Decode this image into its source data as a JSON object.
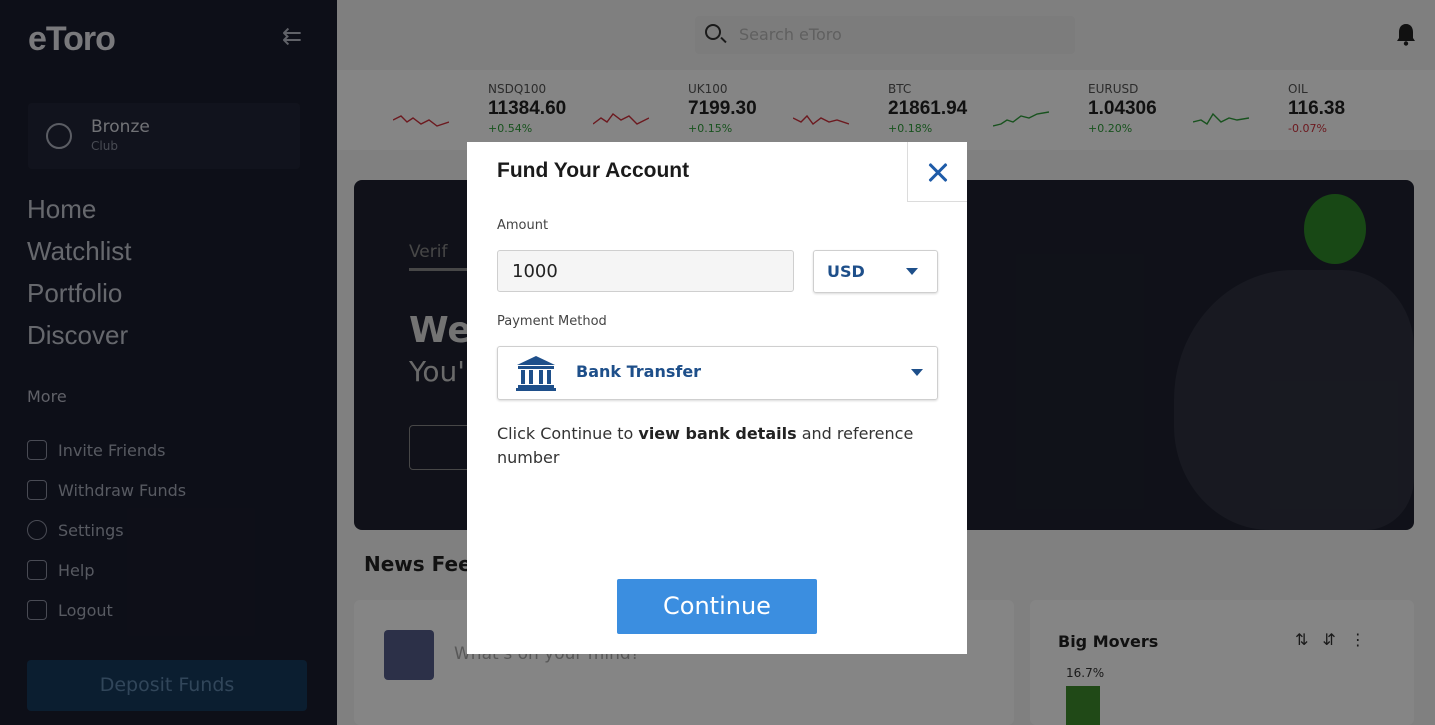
{
  "sidebar": {
    "logo": "eToro",
    "club": {
      "name": "Bronze",
      "sub": "Club"
    },
    "main_items": [
      "Home",
      "Watchlist",
      "Portfolio",
      "Discover"
    ],
    "more_title": "More",
    "more_items": [
      {
        "label": "Invite Friends",
        "icon": "megaphone-icon"
      },
      {
        "label": "Withdraw Funds",
        "icon": "withdraw-icon"
      },
      {
        "label": "Settings",
        "icon": "gear-icon"
      },
      {
        "label": "Help",
        "icon": "help-icon"
      },
      {
        "label": "Logout",
        "icon": "logout-icon"
      }
    ],
    "deposit_label": "Deposit Funds"
  },
  "topbar": {
    "search_placeholder": "Search eToro"
  },
  "ticker": [
    {
      "symbol": "NSDQ100",
      "price": "11384.60",
      "change": "+0.54%",
      "direction": "up"
    },
    {
      "symbol": "UK100",
      "price": "7199.30",
      "change": "+0.15%",
      "direction": "up"
    },
    {
      "symbol": "BTC",
      "price": "21861.94",
      "change": "+0.18%",
      "direction": "up"
    },
    {
      "symbol": "EURUSD",
      "price": "1.04306",
      "change": "+0.20%",
      "direction": "up"
    },
    {
      "symbol": "OIL",
      "price": "116.38",
      "change": "-0.07%",
      "direction": "down"
    }
  ],
  "hero": {
    "verify": "Verif",
    "welcome": "Wel",
    "sub": "You'r"
  },
  "news": {
    "title": "News Feed",
    "post_placeholder": "What's on your mind?"
  },
  "movers": {
    "title": "Big Movers",
    "top_pct": "16.7%"
  },
  "modal": {
    "title": "Fund Your Account",
    "amount_label": "Amount",
    "amount_value": "1000",
    "currency": "USD",
    "payment_label": "Payment Method",
    "payment_method": "Bank Transfer",
    "info_prefix": "Click Continue to ",
    "info_bold": "view bank details",
    "info_suffix": " and reference number",
    "continue_label": "Continue"
  },
  "colors": {
    "accent": "#3b8ee0",
    "link_blue": "#1e4f8a",
    "up": "#2e9e3a",
    "down": "#d0313c"
  }
}
